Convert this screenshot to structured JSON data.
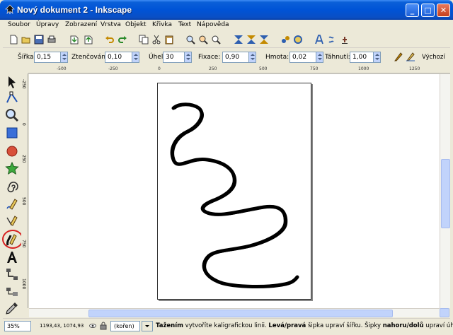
{
  "window": {
    "title": "Nový dokument 2 - Inkscape",
    "controls": {
      "minimize": "_",
      "maximize": "□",
      "close": "✕"
    }
  },
  "menu": [
    "Soubor",
    "Úpravy",
    "Zobrazení",
    "Vrstva",
    "Objekt",
    "Křivka",
    "Text",
    "Nápověda"
  ],
  "toolbar_icons": [
    "new-icon",
    "open-icon",
    "save-icon",
    "print-icon",
    "import-icon",
    "export-icon",
    "undo-icon",
    "redo-icon",
    "copy-icon",
    "cut-icon",
    "paste-icon",
    "zoom-selection-icon",
    "zoom-drawing-icon",
    "zoom-page-icon",
    "align-icon",
    "distribute-icon",
    "group-icon",
    "ungroup-icon",
    "fill-stroke-icon",
    "text-font-icon",
    "xml-editor-icon",
    "preferences-icon"
  ],
  "tool_controls": {
    "width_label": "Šířka:",
    "width_value": "0,15",
    "thinning_label": "Ztenčování:",
    "thinning_value": "0,10",
    "angle_label": "Úhel:",
    "angle_value": "30",
    "fixation_label": "Fixace:",
    "fixation_value": "0,90",
    "mass_label": "Hmota:",
    "mass_value": "0,02",
    "drag_label": "Táhnutí:",
    "drag_value": "1,00",
    "defaults_label": "Výchozí"
  },
  "ruler": {
    "h_ticks": [
      "-500",
      "-250",
      "0",
      "250",
      "500",
      "750",
      "1000",
      "1250"
    ],
    "v_ticks": [
      "-250",
      "0",
      "250",
      "500",
      "750",
      "1000",
      "1250"
    ]
  },
  "tools": [
    "selector-tool",
    "node-tool",
    "zoom-tool",
    "rectangle-tool",
    "ellipse-tool",
    "star-tool",
    "spiral-tool",
    "pencil-tool",
    "pen-tool",
    "calligraphy-tool",
    "text-tool",
    "connector-tool",
    "gradient-tool",
    "dropper-tool"
  ],
  "status": {
    "zoom": "35%",
    "coords": "1193,43, 1074,93",
    "layer": "(kořen)",
    "message_bold1": "Tažením",
    "message_text1": " vytvoříte kaligrafickou linii. ",
    "message_bold2": "Levá/pravá",
    "message_text2": " šipka upraví šířku. Šipky ",
    "message_bold3": "nahoru/dolů",
    "message_text3": " upraví úhel."
  },
  "colors": {
    "titlebar": "#0053d6",
    "chrome": "#ece9d8",
    "highlight": "#d62020"
  }
}
